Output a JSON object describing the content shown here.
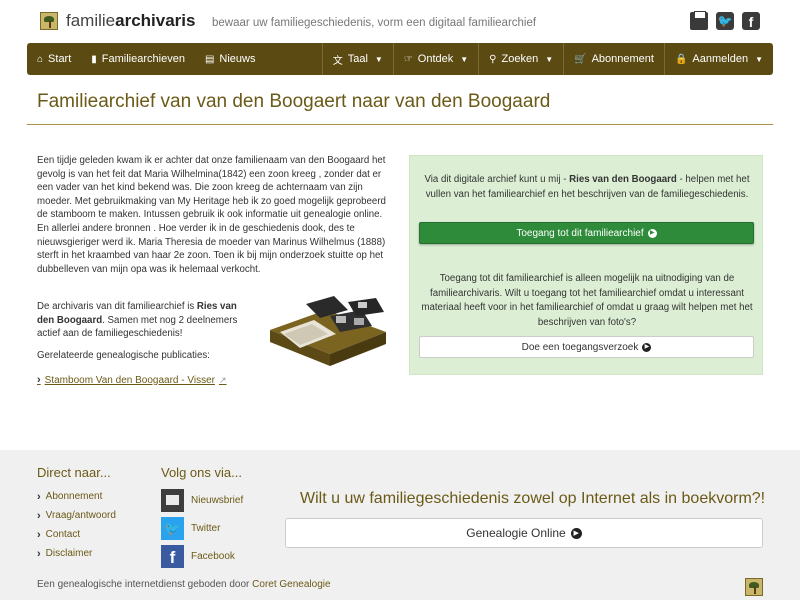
{
  "header": {
    "logo_text_light": "familie",
    "logo_text_bold": "archivaris",
    "tagline": "bewaar uw familiegeschiedenis, vorm een digitaal familiearchief",
    "icons": [
      "print-icon",
      "twitter-icon",
      "facebook-icon"
    ]
  },
  "nav": {
    "start": "Start",
    "familiearchieven": "Familiearchieven",
    "nieuws": "Nieuws",
    "taal": "Taal",
    "ontdek": "Ontdek",
    "zoeken": "Zoeken",
    "abonnement": "Abonnement",
    "aanmelden": "Aanmelden"
  },
  "main": {
    "title": "Familiearchief van van den Boogaert naar van den Boogaard",
    "intro": "Een tijdje geleden kwam ik er achter dat onze familienaam van den Boogaard het gevolg is van het feit dat Maria Wilhelmina(1842) een zoon kreeg , zonder dat er een vader van het kind bekend was. Die zoon kreeg de achternaam van zijn moeder. Met gebruikmaking van My Heritage heb ik zo goed mogelijk geprobeerd de stamboom te maken. Intussen gebruik ik ook informatie uit genealogie online. En allerlei andere bronnen . Hoe verder ik in de geschiedenis dook, des te nieuwsgieriger werd ik. Maria Theresia de moeder van Marinus Wilhelmus (1888) sterft in het kraambed van haar 2e zoon. Toen ik bij mijn onderzoek stuitte op het dubbelleven van mijn opa was ik helemaal verkocht.",
    "archivist_prefix": "De archivaris van dit familiearchief is ",
    "archivist_name": "Ries van den Boogaard",
    "archivist_suffix": ". Samen met nog 2 deelnemers actief aan de familiegeschiedenis!",
    "related_label": "Gerelateerde genealogische publicaties:",
    "related_link": "Stamboom Van den Boogaard - Visser"
  },
  "panel": {
    "text1_prefix": "Via dit digitale archief kunt u mij - ",
    "text1_name": "Ries van den Boogaard",
    "text1_suffix": " - helpen met het vullen van het familiearchief en het beschrijven van de familiegeschiedenis.",
    "access_button": "Toegang tot dit familiearchief",
    "text2": "Toegang tot dit familiearchief is alleen mogelijk na uitnodiging van de familiearchivaris. Wilt u toegang tot het familiearchief omdat u interessant materiaal heeft voor in het familiearchief of omdat u graag wilt helpen met het beschrijven van foto's?",
    "request_button": "Doe een toegangsverzoek"
  },
  "footer": {
    "direct_heading": "Direct naar...",
    "direct_links": [
      "Abonnement",
      "Vraag/antwoord",
      "Contact",
      "Disclaimer"
    ],
    "follow_heading": "Volg ons via...",
    "follow_links": [
      "Nieuwsbrief",
      "Twitter",
      "Facebook"
    ],
    "promo": "Wilt u uw familiegeschiedenis zowel op Internet als in boekvorm?!",
    "promo_button": "Genealogie Online",
    "bottom_prefix": "Een genealogische internetdienst geboden door ",
    "bottom_link": "Coret Genealogie"
  },
  "colors": {
    "accent_brown": "#5b4a11",
    "title_brown": "#6b5a17",
    "panel_green": "#dcefd4",
    "button_green": "#2e8b3a"
  }
}
